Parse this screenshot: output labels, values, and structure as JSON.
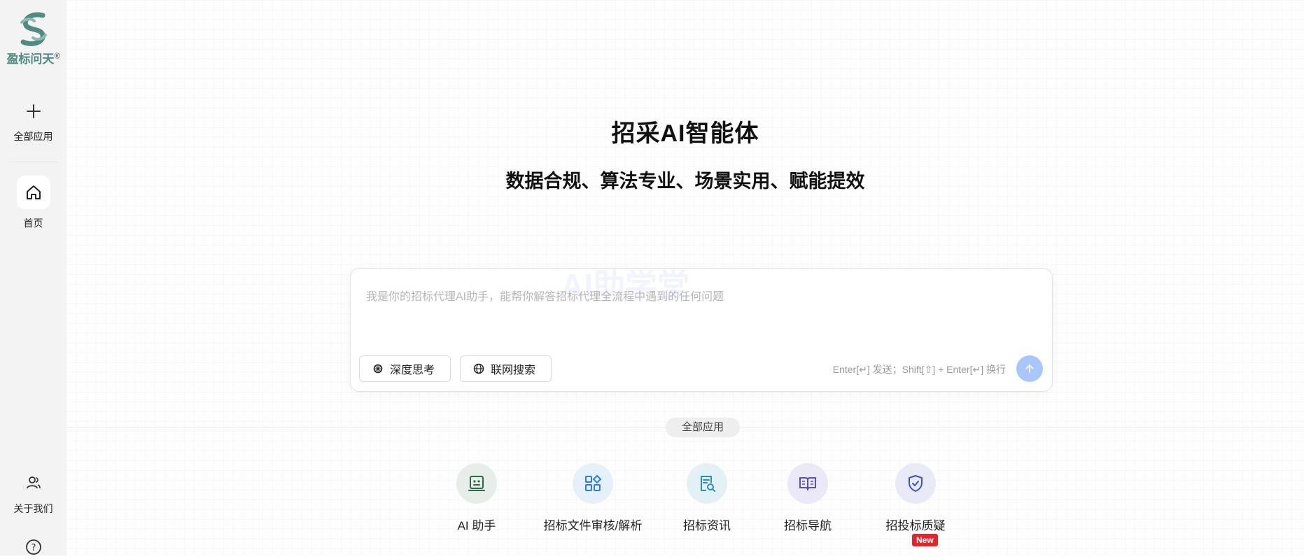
{
  "brand": {
    "name": "盈标问天",
    "mark": "®"
  },
  "sidebar": {
    "all_apps": "全部应用",
    "home": "首页",
    "about": "关于我们"
  },
  "main": {
    "title": "招采AI智能体",
    "subtitle": "数据合规、算法专业、场景实用、赋能提效",
    "input": {
      "placeholder": "我是你的招标代理AI助手，能帮你解答招标代理全流程中遇到的任何问题",
      "watermark": "AI助学堂",
      "deep_think": "深度思考",
      "web_search": "联网搜索",
      "hint": "Enter[↵] 发送；Shift[⇧] + Enter[↵] 换行"
    },
    "section_label": "全部应用",
    "apps": [
      {
        "label": "AI 助手",
        "icon": "robot-face-icon"
      },
      {
        "label": "招标文件审核/解析",
        "icon": "apps-grid-icon"
      },
      {
        "label": "招标资讯",
        "icon": "document-search-icon"
      },
      {
        "label": "招标导航",
        "icon": "open-book-icon"
      },
      {
        "label": "招投标质疑",
        "icon": "shield-certificate-icon",
        "badge": "New"
      }
    ]
  },
  "colors": {
    "logo": "#4f8b83",
    "send": "#a9c6fa",
    "badge": "#e8242a"
  }
}
